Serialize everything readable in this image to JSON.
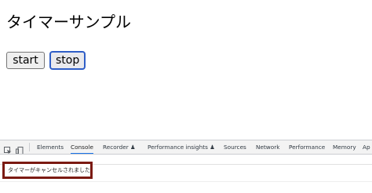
{
  "page": {
    "title": "タイマーサンプル",
    "start_label": "start",
    "stop_label": "stop"
  },
  "devtools": {
    "tabs": [
      {
        "label": "Elements"
      },
      {
        "label": "Console",
        "active": true
      },
      {
        "label": "Recorder ♟"
      },
      {
        "label": "Performance insights ♟"
      },
      {
        "label": "Sources"
      },
      {
        "label": "Network"
      },
      {
        "label": "Performance"
      },
      {
        "label": "Memory"
      },
      {
        "label": "Ap"
      }
    ],
    "console_message": "タイマーがキャンセルされました"
  },
  "colors": {
    "highlight_border": "#7b1a12",
    "stop_button_focus": "#2f5ec7",
    "active_tab_underline": "#1a73e8"
  }
}
